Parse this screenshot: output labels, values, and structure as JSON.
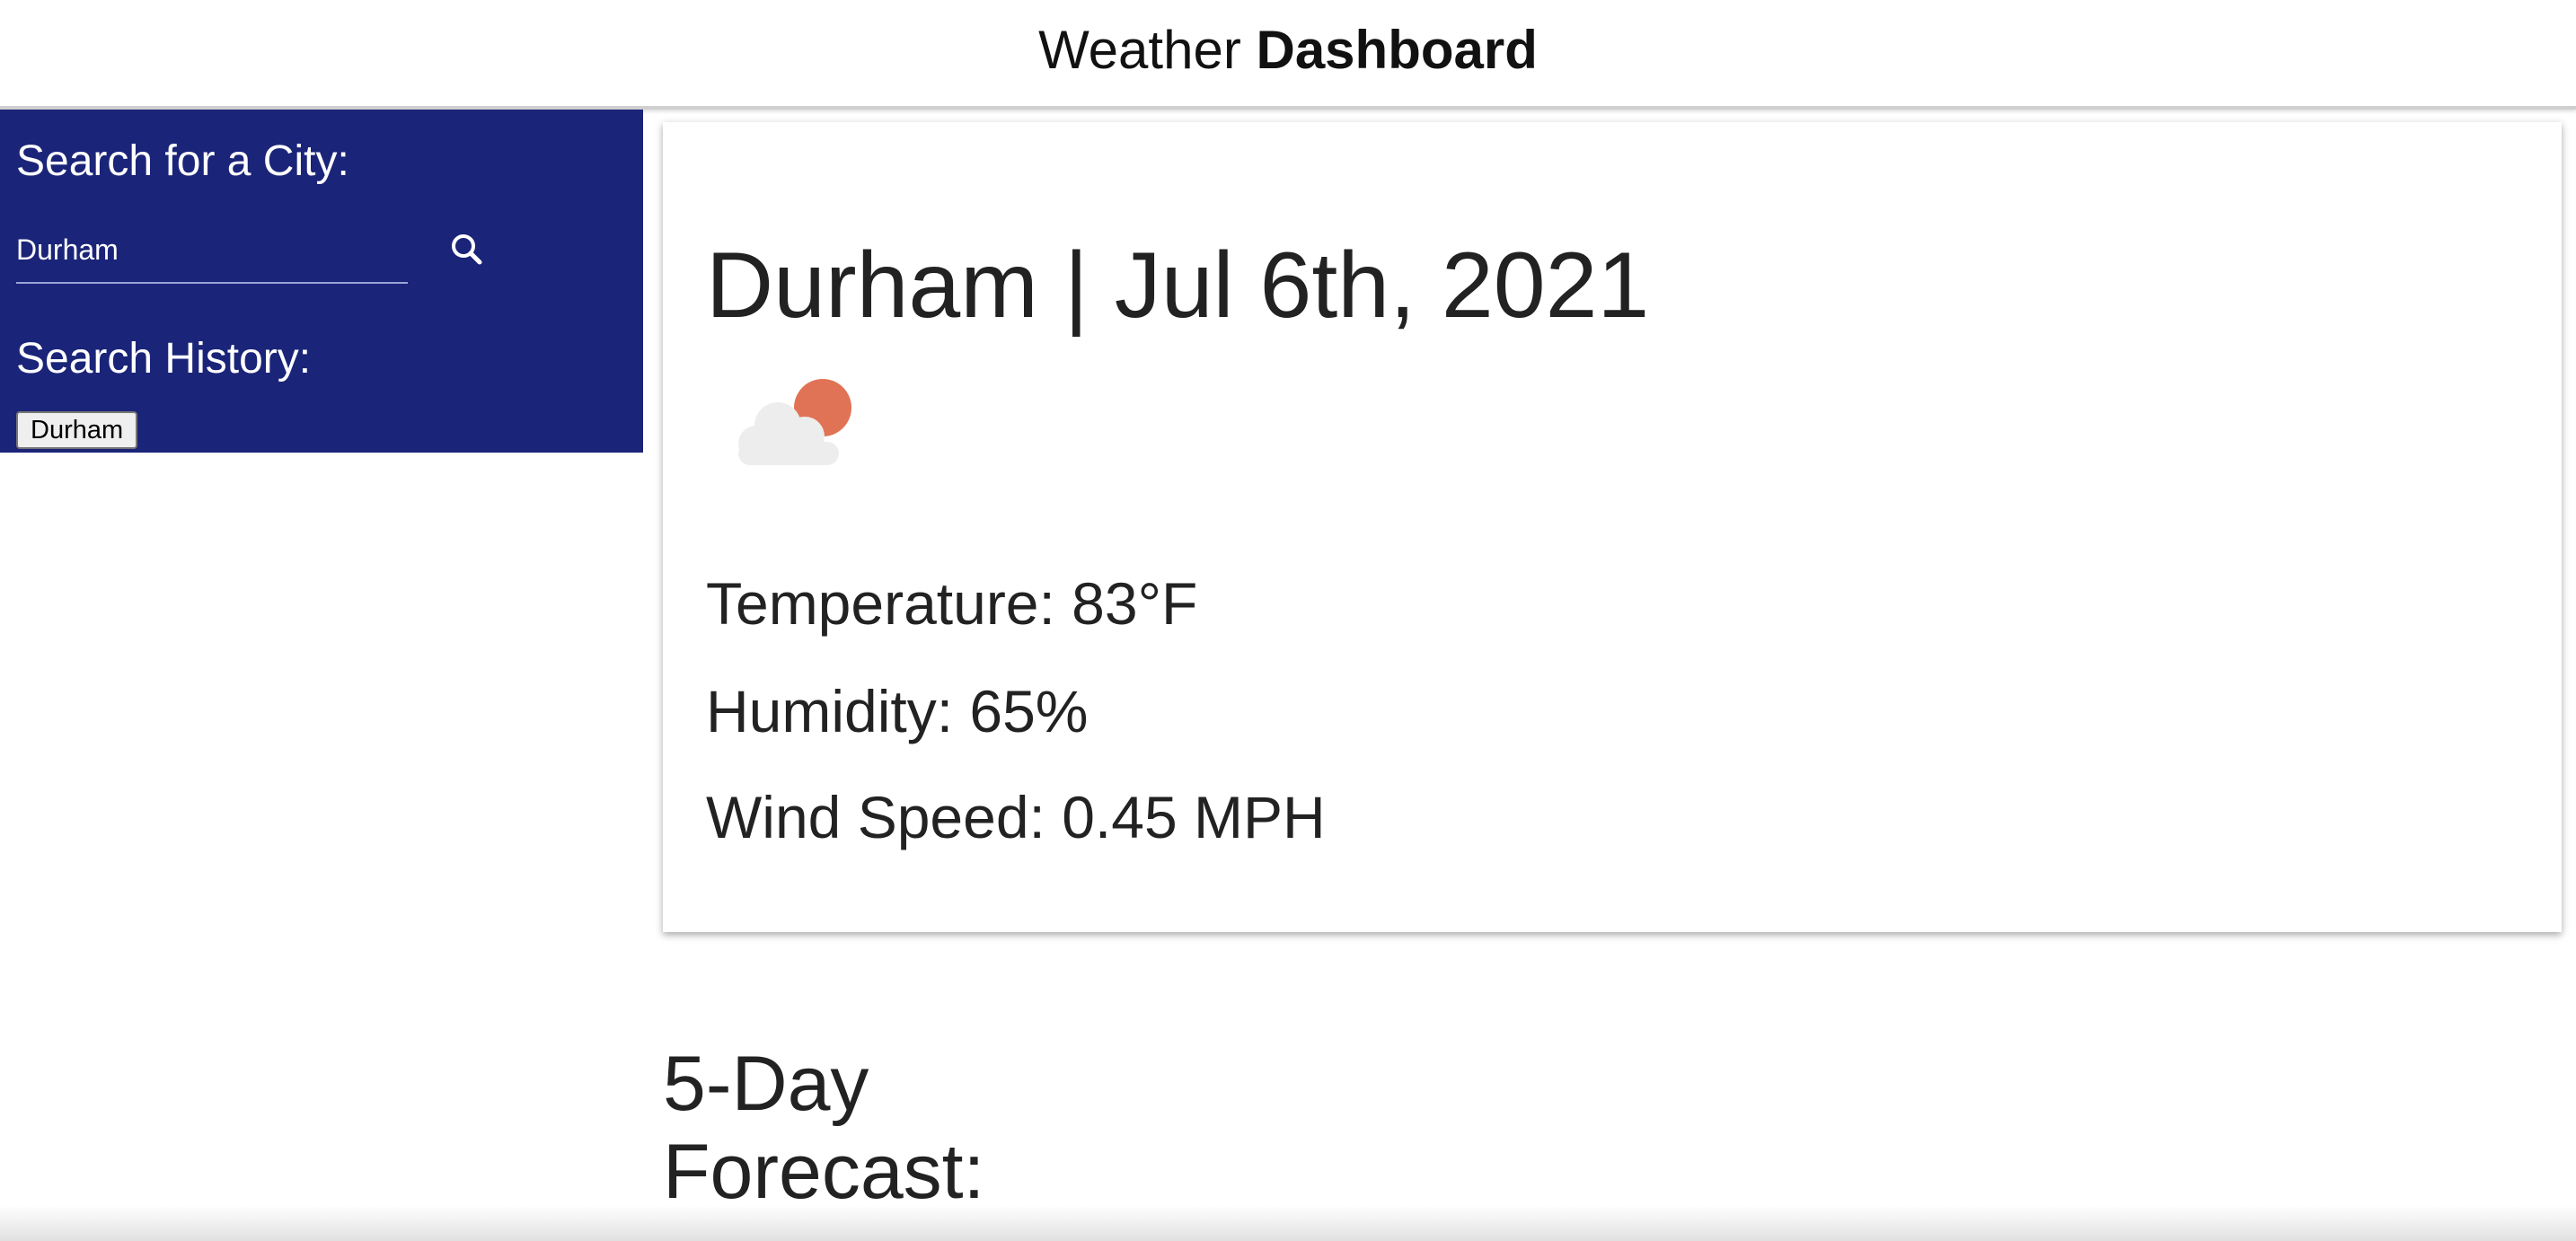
{
  "header": {
    "title_prefix": "Weather",
    "title_bold": "Dashboard"
  },
  "sidebar": {
    "search_heading": "Search for a City:",
    "search_value": "Durham",
    "search_icon": "search-icon",
    "history_heading": "Search History:",
    "history_items": [
      "Durham"
    ],
    "background_color": "#1a2478"
  },
  "current": {
    "city_date": "Durham | Jul 6th, 2021",
    "icon": "partly-cloudy-icon",
    "temperature": "Temperature: 83°F",
    "humidity": "Humidity: 65%",
    "wind_speed": "Wind Speed: 0.45 MPH"
  },
  "forecast": {
    "title": "5-Day Forecast:"
  }
}
